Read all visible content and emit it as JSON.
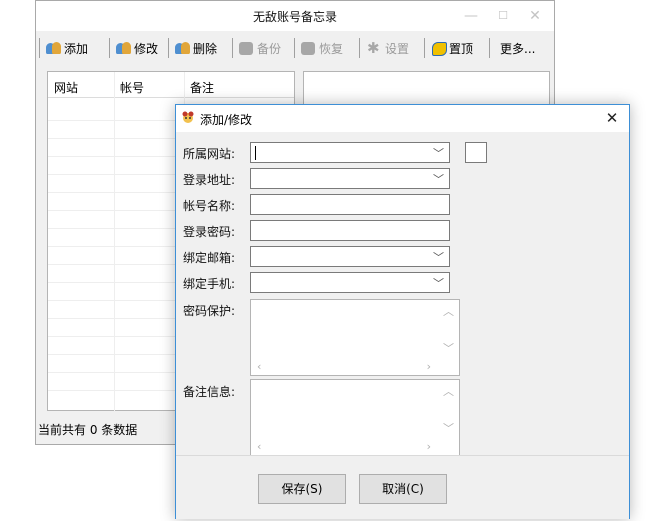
{
  "main_window": {
    "title": "无敌账号备忘录",
    "toolbar": {
      "add": "添加",
      "edit": "修改",
      "delete": "删除",
      "backup": "备份",
      "restore": "恢复",
      "settings": "设置",
      "pin": "置顶",
      "more": "更多..."
    },
    "columns": [
      "网站",
      "帐号",
      "备注"
    ],
    "status": "当前共有 0 条数据"
  },
  "dialog": {
    "title": "添加/修改",
    "fields": {
      "site_label": "所属网站:",
      "url_label": "登录地址:",
      "account_label": "帐号名称:",
      "password_label": "登录密码:",
      "email_label": "绑定邮箱:",
      "phone_label": "绑定手机:",
      "security_label": "密码保护:",
      "note_label": "备注信息:"
    },
    "values": {
      "site": "",
      "url": "",
      "account": "",
      "password": "",
      "email": "",
      "phone": "",
      "security": "",
      "note": ""
    },
    "save_button": "保存(S)",
    "cancel_button": "取消(C)"
  },
  "icons": {
    "minimize": "minimize-icon",
    "maximize": "maximize-icon",
    "close": "close-icon",
    "dropdown": "chevron-down-icon"
  },
  "colors": {
    "dialog_border": "#3d8fd6",
    "window_bg": "#f0f0f0",
    "disabled_text": "#9a9a9a"
  }
}
